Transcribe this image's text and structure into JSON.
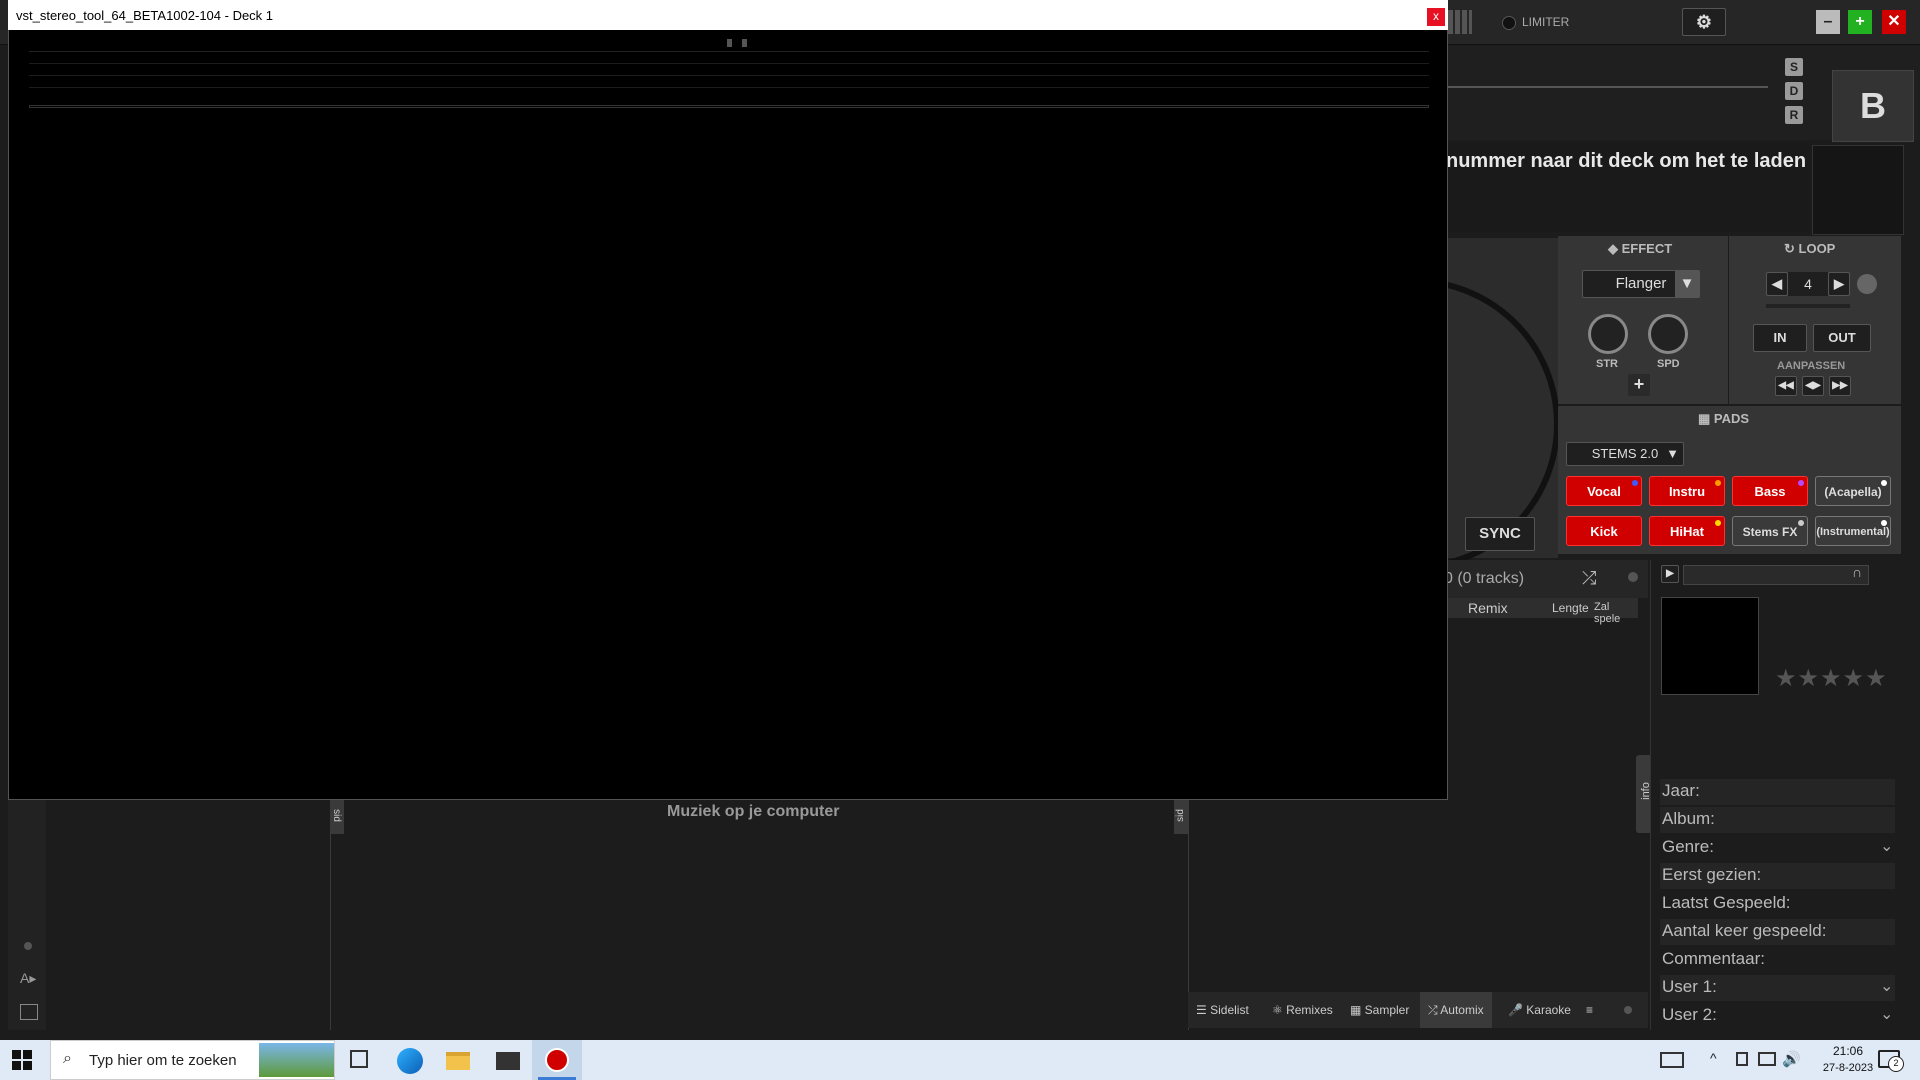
{
  "vdj": {
    "limiter_label": "LIMITER",
    "deck_letter": "B",
    "sdr_buttons": [
      "S",
      "D",
      "R"
    ],
    "load_hint": "nummer naar dit deck om het te laden",
    "effect": {
      "title": "EFFECT",
      "selected": "Flanger",
      "knob1": "STR",
      "knob2": "SPD",
      "add": "+"
    },
    "loop": {
      "title": "LOOP",
      "value": "4",
      "in": "IN",
      "out": "OUT",
      "adjust": "AANPASSEN"
    },
    "pads": {
      "title": "PADS",
      "mode": "STEMS 2.0",
      "row1": [
        "Vocal",
        "Instru",
        "Bass",
        "(Acapella)"
      ],
      "row2": [
        "Kick",
        "HiHat",
        "Stems FX",
        "(Instrumental)"
      ]
    },
    "sync": "SYNC",
    "tracks_count": "0 (0 tracks)",
    "columns": [
      "Remix",
      "Lengte",
      "Zal spele"
    ],
    "browser_folder": "Muziek op je computer",
    "side_tabs": [
      "info",
      "sid",
      "sid"
    ],
    "info_fields": [
      "Jaar:",
      "Album:",
      "Genre:",
      "Eerst gezien:",
      "Laatst Gespeeld:",
      "Aantal keer gespeeld:",
      "Commentaar:",
      "User 1:",
      "User 2:"
    ],
    "bottom_tabs": [
      "Sidelist",
      "Remixes",
      "Sampler",
      "Automix",
      "Karaoke"
    ],
    "colors": {
      "accent_red": "#d10000",
      "accent_green": "#21b121"
    }
  },
  "plugin_window": {
    "title": "vst_stereo_tool_64_BETA1002-104 - Deck 1",
    "close": "x"
  },
  "taskbar": {
    "search_placeholder": "Typ hier om te zoeken",
    "time": "21:06",
    "date": "27-8-2023",
    "notifications": "2"
  }
}
